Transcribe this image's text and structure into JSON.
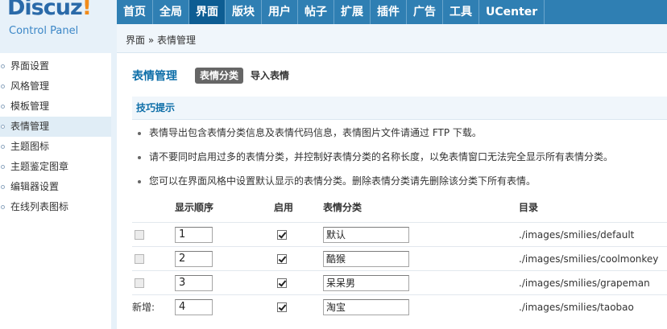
{
  "logo": {
    "brand": "Discuz",
    "bang": "!",
    "subtitle": "Control Panel"
  },
  "topnav": [
    "首页",
    "全局",
    "界面",
    "版块",
    "用户",
    "帖子",
    "扩展",
    "插件",
    "广告",
    "工具",
    "UCenter"
  ],
  "breadcrumb": "界面 » 表情管理",
  "sidebar": [
    "界面设置",
    "风格管理",
    "模板管理",
    "表情管理",
    "主题图标",
    "主题鉴定图章",
    "编辑器设置",
    "在线列表图标"
  ],
  "main": {
    "title": "表情管理",
    "tabs": [
      "表情分类",
      "导入表情"
    ],
    "tips_title": "技巧提示",
    "tips": [
      "表情导出包含表情分类信息及表情代码信息，表情图片文件请通过 FTP 下载。",
      "请不要同时启用过多的表情分类，并控制好表情分类的名称长度，以免表情窗口无法完全显示所有表情分类。",
      "您可以在界面风格中设置默认显示的表情分类。删除表情分类请先删除该分类下所有表情。"
    ],
    "table": {
      "headers": [
        "显示顺序",
        "启用",
        "表情分类",
        "目录"
      ],
      "rows": [
        {
          "order": "1",
          "name": "默认",
          "dir": "./images/smilies/default"
        },
        {
          "order": "2",
          "name": "酷猴",
          "dir": "./images/smilies/coolmonkey"
        },
        {
          "order": "3",
          "name": "呆呆男",
          "dir": "./images/smilies/grapeman"
        }
      ],
      "new_row": {
        "label": "新增:",
        "order": "4",
        "name": "淘宝",
        "dir": "./images/smilies/taobao"
      }
    }
  }
}
